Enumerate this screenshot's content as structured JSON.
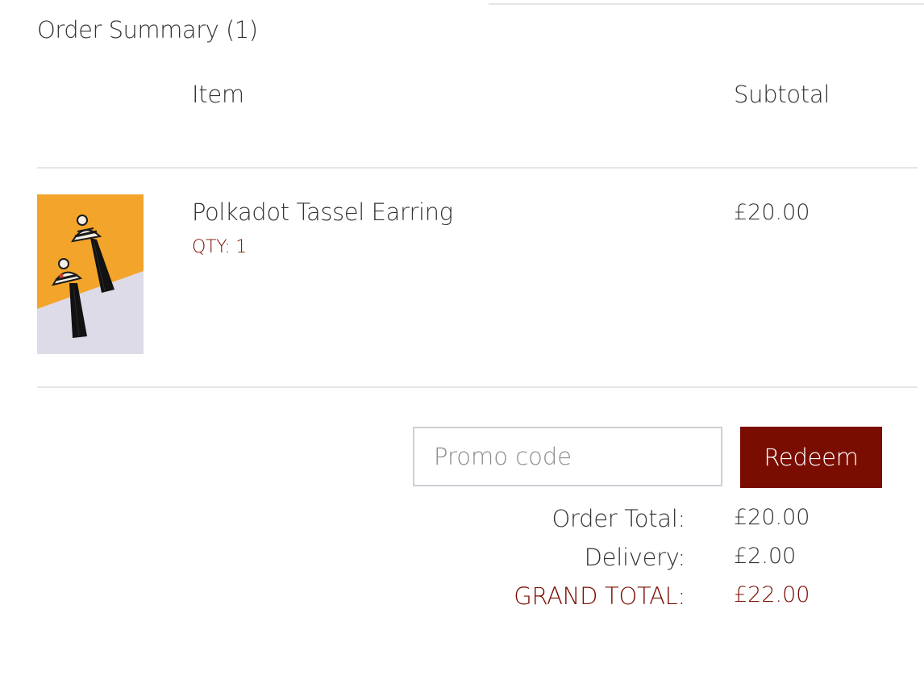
{
  "order_summary": {
    "title": "Order Summary (1)"
  },
  "columns": {
    "item": "Item",
    "subtotal": "Subtotal"
  },
  "items": [
    {
      "name": "Polkadot Tassel Earring",
      "qty_label": "QTY:",
      "qty": "1",
      "subtotal": "£20.00"
    }
  ],
  "promo": {
    "placeholder": "Promo code",
    "value": "",
    "button_label": "Redeem"
  },
  "totals": {
    "order_total_label": "Order Total:",
    "order_total_value": "£20.00",
    "delivery_label": "Delivery:",
    "delivery_value": "£2.00",
    "grand_total_label": "GRAND TOTAL:",
    "grand_total_value": "£22.00"
  },
  "colors": {
    "accent": "#7a0d02",
    "text": "#333333",
    "divider": "#e6e6e6",
    "product_bg_top": "#f2a52a",
    "product_bg_bottom": "#dedbe8"
  }
}
